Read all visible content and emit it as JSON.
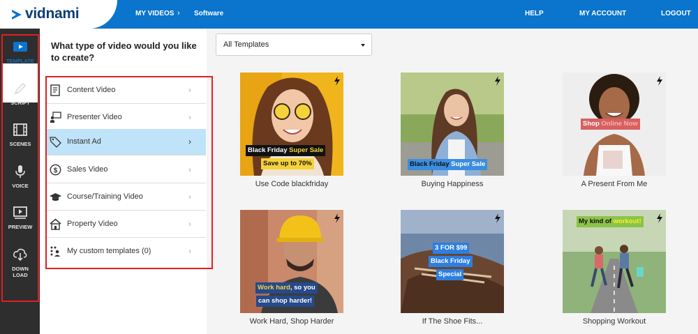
{
  "app": {
    "logo_text": "vidnami"
  },
  "topnav": {
    "my_videos": "MY VIDEOS",
    "crumb": "Software",
    "help": "HELP",
    "account": "MY ACCOUNT",
    "logout": "LOGOUT"
  },
  "rail": [
    {
      "label": "TEMPLATE",
      "icon": "play-icon",
      "active": true
    },
    {
      "label": "SCRIPT",
      "icon": "pen-icon"
    },
    {
      "label": "SCENES",
      "icon": "film-icon"
    },
    {
      "label": "VOICE",
      "icon": "microphone-icon"
    },
    {
      "label": "PREVIEW",
      "icon": "preview-icon"
    },
    {
      "label_line1": "DOWN",
      "label_line2": "LOAD",
      "icon": "download-icon"
    }
  ],
  "panel": {
    "title": "What type of video would you like to create?",
    "items": [
      {
        "label": "Content Video",
        "icon": "document-icon"
      },
      {
        "label": "Presenter Video",
        "icon": "presenter-icon"
      },
      {
        "label": "Instant Ad",
        "icon": "tag-icon",
        "selected": true
      },
      {
        "label": "Sales Video",
        "icon": "dollar-icon"
      },
      {
        "label": "Course/Training Video",
        "icon": "graduation-cap-icon"
      },
      {
        "label": "Property Video",
        "icon": "house-icon"
      },
      {
        "label": "My custom templates (0)",
        "icon": "custom-grid-icon"
      }
    ]
  },
  "filter": {
    "value": "All Templates"
  },
  "cards": [
    {
      "caption": "Use Code blackfriday",
      "tag1a": "Black Friday ",
      "tag1b": "Super Sale",
      "tag2": "Save up to 70%"
    },
    {
      "caption": "Buying Happiness",
      "tag1a": "Black Friday ",
      "tag1b": "Super Sale"
    },
    {
      "caption": "A Present From Me",
      "tag1a": "Shop ",
      "tag1b": "Online Now"
    },
    {
      "caption": "Work Hard, Shop Harder",
      "tag1a": "Work hard",
      "tag1b": ", so you",
      "tag2": "can shop harder!"
    },
    {
      "caption": "If The Shoe Fits...",
      "tag1": "3 FOR $99",
      "tag2": "Black Friday",
      "tag3": "Special"
    },
    {
      "caption": "Shopping Workout",
      "tag1a": "My kind of ",
      "tag1b": "workout!"
    }
  ],
  "colors": {
    "topbar": "#0b74cc",
    "rail": "#2e2e2e",
    "selected": "#bfe3f8",
    "outline": "#e02020"
  }
}
